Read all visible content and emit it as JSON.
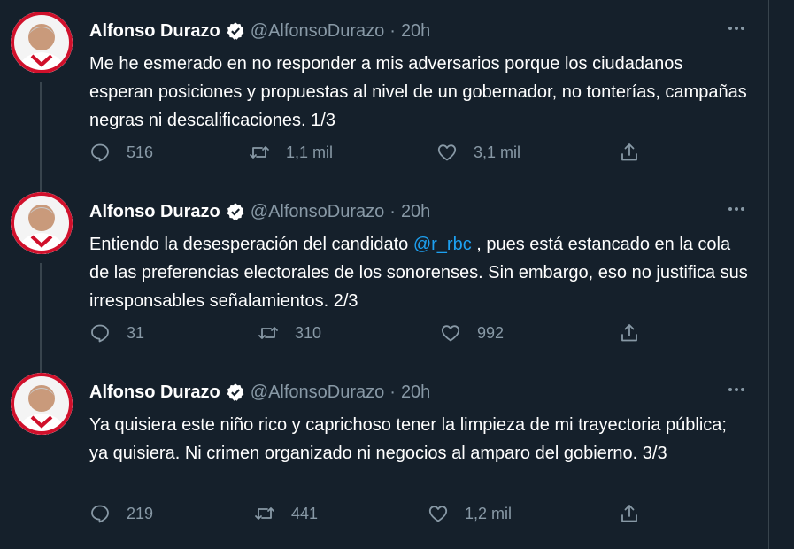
{
  "tweets": [
    {
      "name": "Alfonso Durazo",
      "handle": "@AlfonsoDurazo",
      "separator": "·",
      "time": "20h",
      "text_before": "Me he esmerado en no responder a mis adversarios porque los ciudadanos esperan posiciones y propuestas al nivel de un gobernador, no tonterías, campañas negras ni descalificaciones. 1/3",
      "mention": "",
      "text_after": "",
      "replies": "516",
      "retweets": "1,1 mil",
      "likes": "3,1 mil"
    },
    {
      "name": "Alfonso Durazo",
      "handle": "@AlfonsoDurazo",
      "separator": "·",
      "time": "20h",
      "text_before": "Entiendo la desesperación del candidato ",
      "mention": "@r_rbc",
      "text_after": " , pues está estancado en la cola de las preferencias electorales de los sonorenses. Sin embargo, eso no justifica sus irresponsables señalamientos. 2/3",
      "replies": "31",
      "retweets": "310",
      "likes": "992"
    },
    {
      "name": "Alfonso Durazo",
      "handle": "@AlfonsoDurazo",
      "separator": "·",
      "time": "20h",
      "text_before": "Ya quisiera este niño rico y caprichoso tener la limpieza de mi trayectoria pública; ya quisiera. Ni crimen organizado ni negocios al amparo del gobierno. 3/3",
      "mention": "",
      "text_after": "",
      "replies": "219",
      "retweets": "441",
      "likes": "1,2 mil"
    }
  ],
  "colors": {
    "background": "#15202b",
    "text": "#ffffff",
    "secondary": "#8899a6",
    "link": "#1da1f2",
    "border": "#38444d"
  },
  "icons": [
    "reply-icon",
    "retweet-icon",
    "like-icon",
    "share-icon",
    "verified-icon",
    "more-icon"
  ]
}
